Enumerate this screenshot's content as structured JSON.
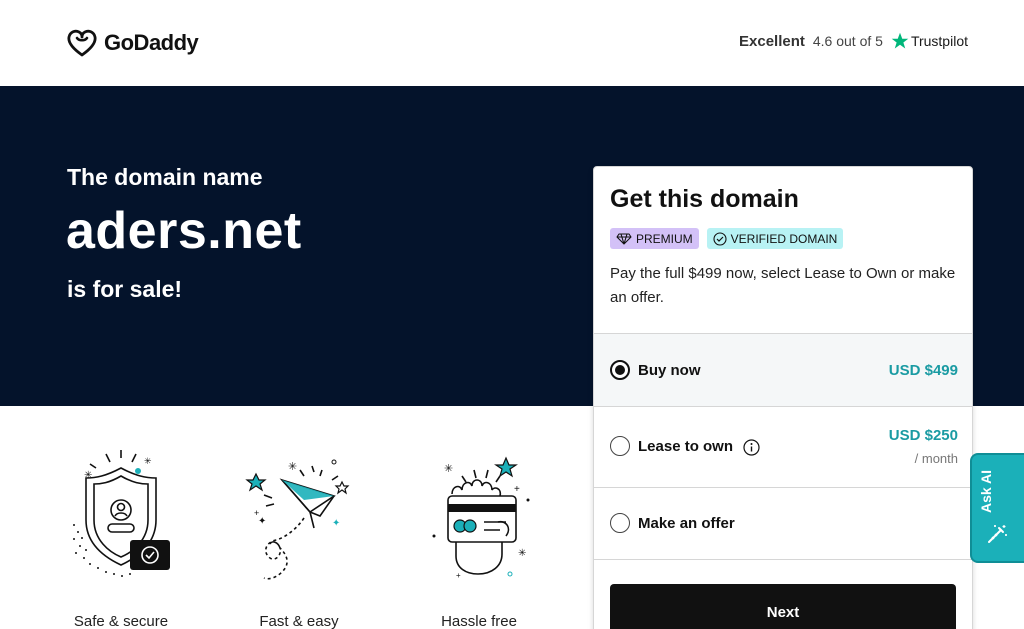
{
  "header": {
    "brand": "GoDaddy",
    "trust_excellent": "Excellent",
    "trust_rating": "4.6 out of 5",
    "trust_brand": "Trustpilot"
  },
  "hero": {
    "pre_text": "The domain name",
    "domain": "aders.net",
    "post_text": "is for sale!"
  },
  "features": [
    {
      "label": "Safe & secure",
      "icon": "shield-icon"
    },
    {
      "label": "Fast & easy",
      "icon": "paper-plane-icon"
    },
    {
      "label": "Hassle free",
      "icon": "card-hand-icon"
    }
  ],
  "card": {
    "title": "Get this domain",
    "badge_premium": "PREMIUM",
    "badge_verified": "VERIFIED DOMAIN",
    "description": "Pay the full $499 now, select Lease to Own or make an offer.",
    "options": [
      {
        "label": "Buy now",
        "price": "USD $499",
        "selected": true
      },
      {
        "label": "Lease to own",
        "price": "USD $250",
        "sub": "/ month",
        "selected": false
      },
      {
        "label": "Make an offer",
        "selected": false
      }
    ],
    "next_label": "Next"
  },
  "ask_ai": {
    "label": "Ask AI"
  },
  "colors": {
    "hero_bg": "#04132b",
    "accent_teal": "#1a9ba3",
    "premium_badge": "#d3c1f7",
    "verified_badge": "#b8f2f4",
    "ask_ai_bg": "#1bb0b9"
  }
}
